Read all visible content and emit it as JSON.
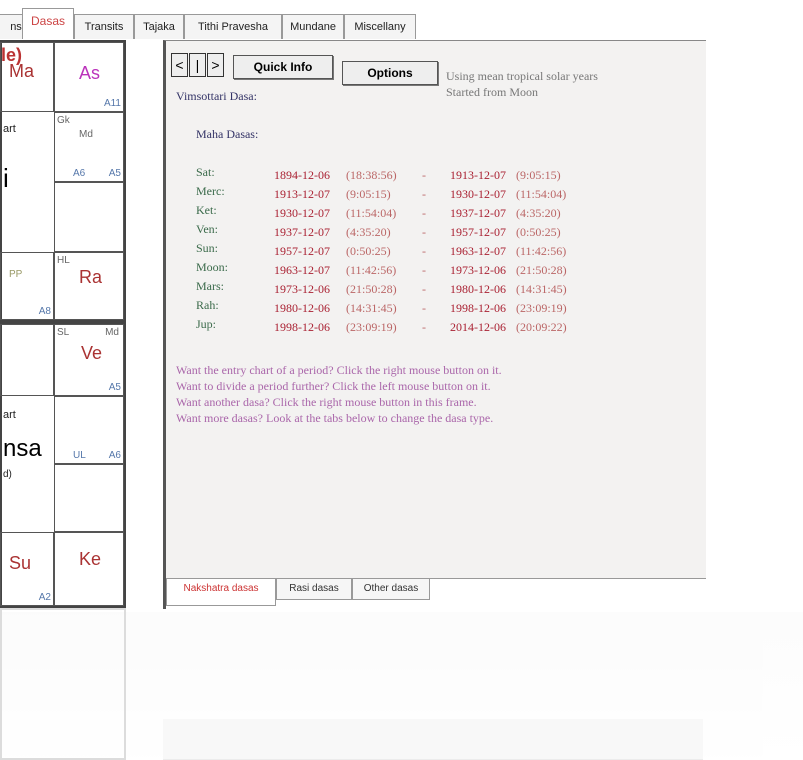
{
  "tabs": [
    {
      "label": "ns"
    },
    {
      "label": "Dasas"
    },
    {
      "label": "Transits"
    },
    {
      "label": "Tajaka"
    },
    {
      "label": "Tithi Pravesha"
    },
    {
      "label": "Mundane"
    },
    {
      "label": "Miscellany"
    }
  ],
  "chart1": {
    "c1": "le)",
    "c1b": "Ma",
    "c2": "As",
    "c2a": "A11",
    "c3": "art",
    "c3b": "i",
    "c4": "Gk",
    "c4b": "Md",
    "c4c": "A6",
    "c4d": "A5",
    "c5": "PP",
    "c5a": "A8",
    "c6": "HL",
    "c6b": "Ra"
  },
  "chart2": {
    "c1": "SL",
    "c1b": "Md",
    "c1c": "Ve",
    "c1d": "A5",
    "c2": "art",
    "c2b": "nsa",
    "c2c": "d)",
    "c3": "UL",
    "c3b": "A6",
    "c4": "Su",
    "c4a": "A2",
    "c5": "Ke"
  },
  "toolbar": {
    "prev": "<",
    "mid": "|",
    "next": ">",
    "quick_info": "Quick Info",
    "options": "Options",
    "note1": "Using mean tropical solar years",
    "note2": "Started from Moon"
  },
  "dasa": {
    "title": "Vimsottari Dasa:",
    "subtitle": "Maha Dasas:",
    "rows": [
      {
        "planet": "Sat:",
        "start": "1894-12-06",
        "start_time": "(18:38:56)",
        "sep": "-",
        "end": "1913-12-07",
        "end_time": "(9:05:15)"
      },
      {
        "planet": "Merc:",
        "start": "1913-12-07",
        "start_time": "(9:05:15)",
        "sep": "-",
        "end": "1930-12-07",
        "end_time": "(11:54:04)"
      },
      {
        "planet": "Ket:",
        "start": "1930-12-07",
        "start_time": "(11:54:04)",
        "sep": "-",
        "end": "1937-12-07",
        "end_time": "(4:35:20)"
      },
      {
        "planet": "Ven:",
        "start": "1937-12-07",
        "start_time": "(4:35:20)",
        "sep": "-",
        "end": "1957-12-07",
        "end_time": "(0:50:25)"
      },
      {
        "planet": "Sun:",
        "start": "1957-12-07",
        "start_time": "(0:50:25)",
        "sep": "-",
        "end": "1963-12-07",
        "end_time": "(11:42:56)"
      },
      {
        "planet": "Moon:",
        "start": "1963-12-07",
        "start_time": "(11:42:56)",
        "sep": "-",
        "end": "1973-12-06",
        "end_time": "(21:50:28)"
      },
      {
        "planet": "Mars:",
        "start": "1973-12-06",
        "start_time": "(21:50:28)",
        "sep": "-",
        "end": "1980-12-06",
        "end_time": "(14:31:45)"
      },
      {
        "planet": "Rah:",
        "start": "1980-12-06",
        "start_time": "(14:31:45)",
        "sep": "-",
        "end": "1998-12-06",
        "end_time": "(23:09:19)"
      },
      {
        "planet": "Jup:",
        "start": "1998-12-06",
        "start_time": "(23:09:19)",
        "sep": "-",
        "end": "2014-12-06",
        "end_time": "(20:09:22)"
      }
    ]
  },
  "help": [
    "Want the entry chart of a period? Click the right mouse button on it.",
    "Want to divide a period further? Click the left mouse button on it.",
    "Want another dasa? Click the right mouse button in this frame.",
    "Want more dasas? Look at the tabs below to change the dasa type."
  ],
  "bottom_tabs": [
    {
      "label": "Nakshatra dasas"
    },
    {
      "label": "Rasi dasas"
    },
    {
      "label": "Other dasas"
    }
  ]
}
